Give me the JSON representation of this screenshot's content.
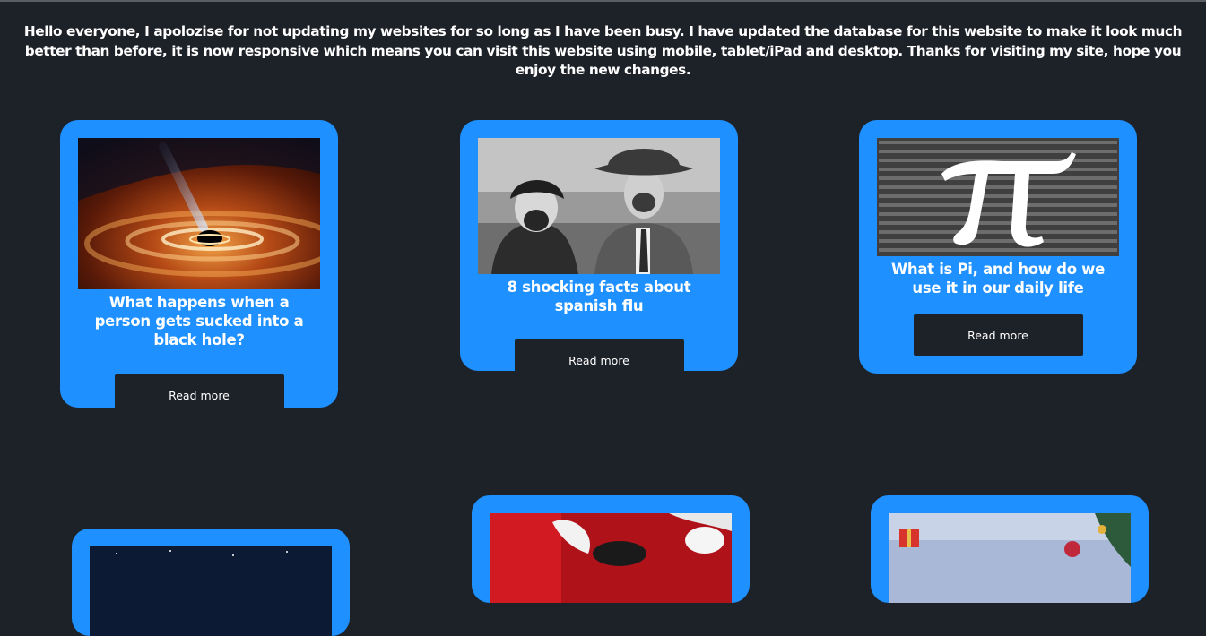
{
  "announcement": "Hello everyone, I apolozise for not updating my websites for so long as I have been busy. I have updated the database for this website to make it look much better than before, it is now responsive which means you can visit this website using mobile, tablet/iPad and desktop. Thanks for visiting my site, hope you enjoy the new changes.",
  "colors": {
    "page_background": "#1d2128",
    "card_background": "#1e90ff",
    "button_background": "#1d2128",
    "text": "#ffffff"
  },
  "articles": [
    {
      "title": "What happens when a person gets sucked into a black hole?",
      "button": "Read more",
      "image": "black-hole-image"
    },
    {
      "title": "8 shocking facts about spanish flu",
      "button": "Read more",
      "image": "spanish-flu-photo"
    },
    {
      "title": "What is Pi, and how do we use it in our daily life",
      "button": "Read more",
      "image": "pi-symbol-image"
    },
    {
      "image": "night-sky-image"
    },
    {
      "image": "santa-claus-image"
    },
    {
      "image": "christmas-background-image"
    }
  ]
}
